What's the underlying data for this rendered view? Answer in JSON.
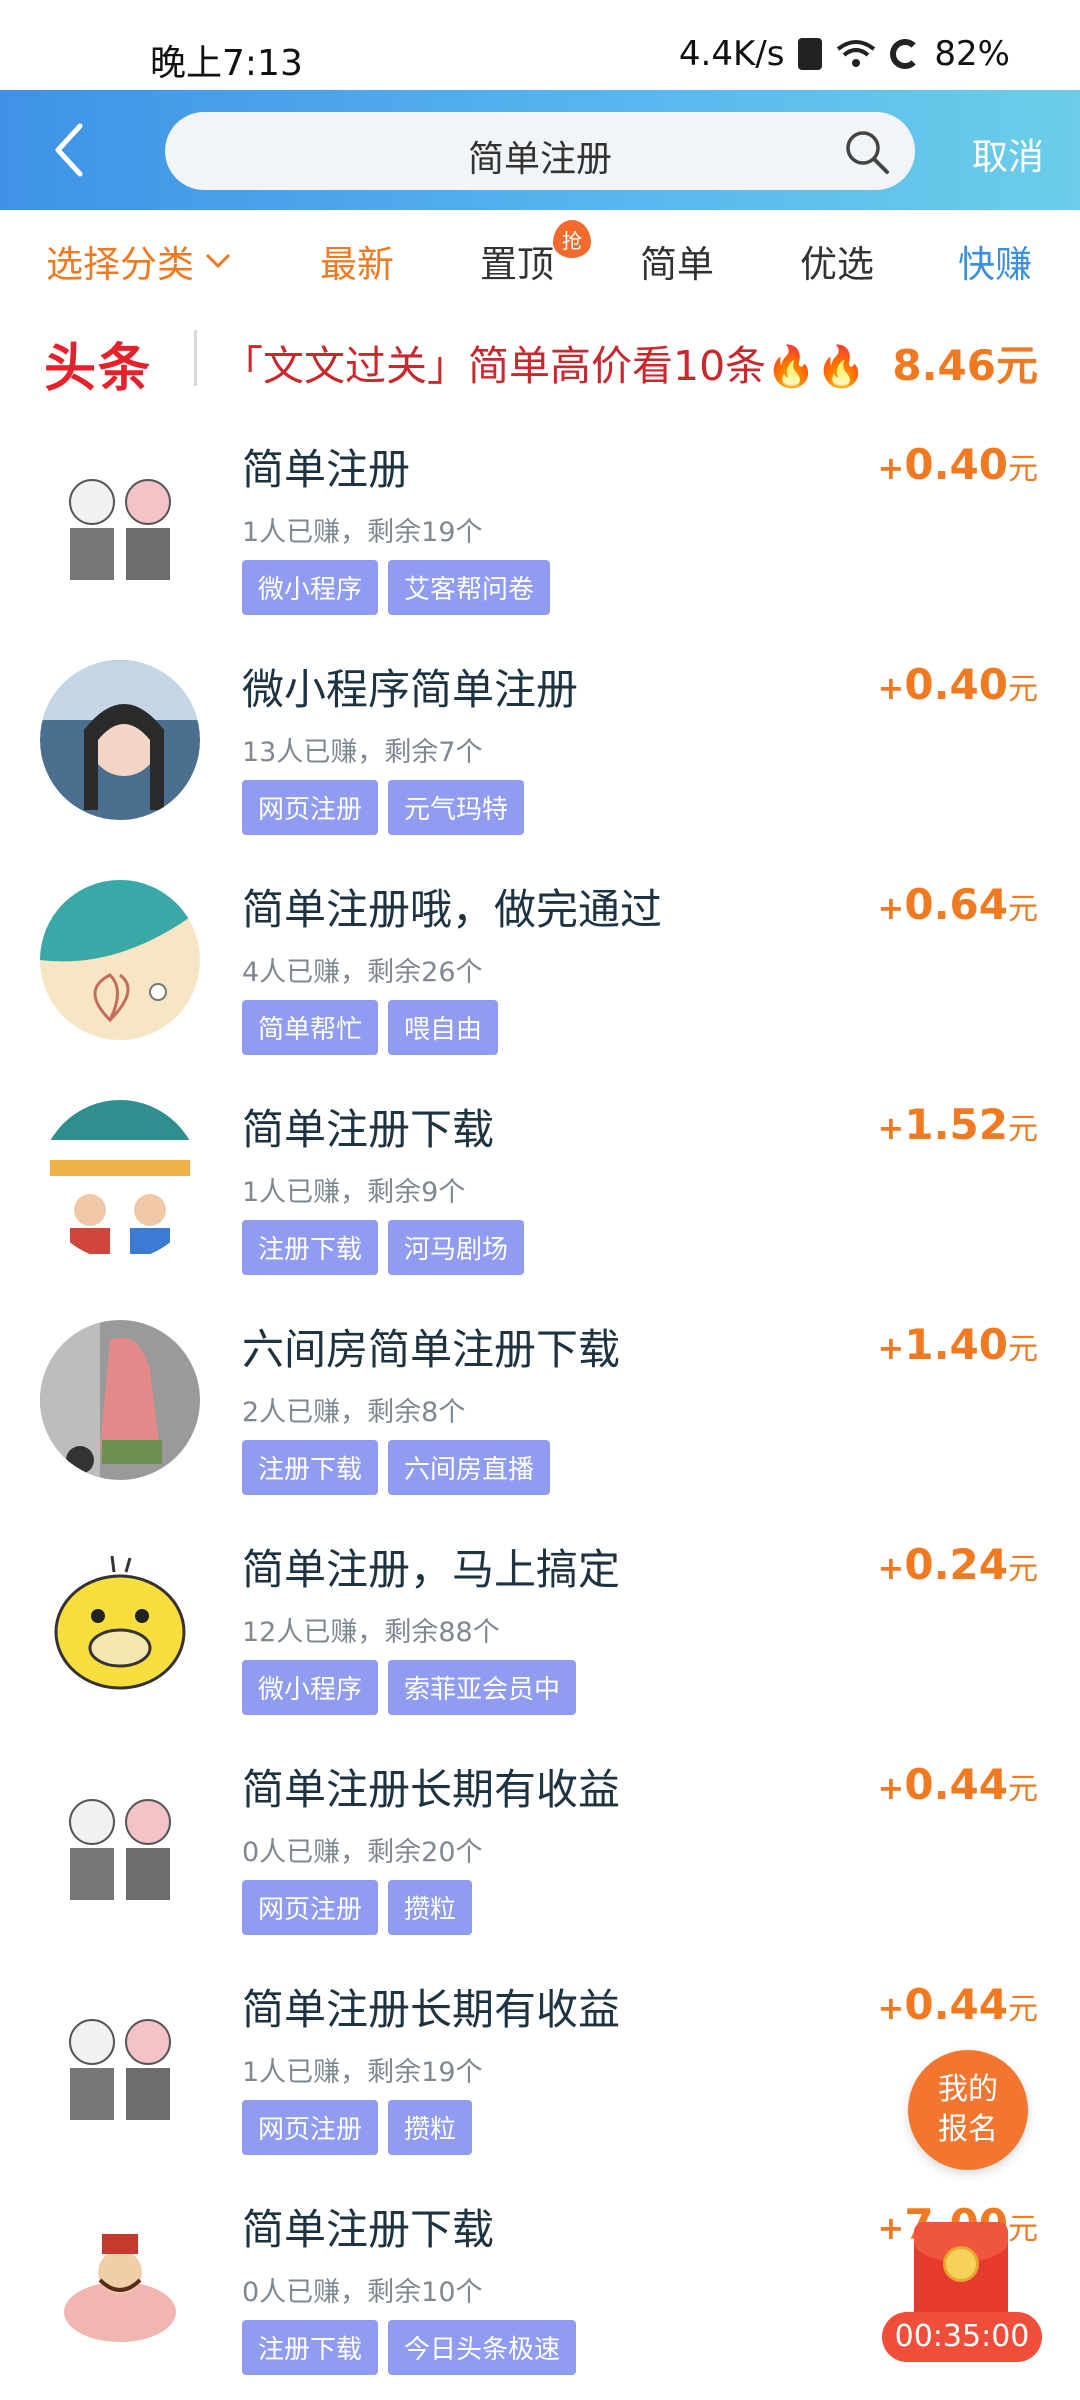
{
  "status_bar": {
    "time": "晚上7:13",
    "speed": "4.4K/s",
    "battery": "82%"
  },
  "header": {
    "search_value": "简单注册",
    "cancel_label": "取消"
  },
  "tabs": {
    "category": "选择分类",
    "items": [
      "最新",
      "置顶",
      "简单",
      "优选",
      "快赚"
    ],
    "badge": "抢"
  },
  "headline": {
    "logo": "头条",
    "text": "「文文过关」简单高价看10条",
    "price": "8.46元"
  },
  "tasks": [
    {
      "title": "简单注册",
      "stats": "1人已赚，剩余19个",
      "tags": [
        "微小程序",
        "艾客帮问卷"
      ],
      "price": "0.40"
    },
    {
      "title": "微小程序简单注册",
      "stats": "13人已赚，剩余7个",
      "tags": [
        "网页注册",
        "元气玛特"
      ],
      "price": "0.40"
    },
    {
      "title": "简单注册哦，做完通过",
      "stats": "4人已赚，剩余26个",
      "tags": [
        "简单帮忙",
        "喂自由"
      ],
      "price": "0.64"
    },
    {
      "title": "简单注册下载",
      "stats": "1人已赚，剩余9个",
      "tags": [
        "注册下载",
        "河马剧场"
      ],
      "price": "1.52"
    },
    {
      "title": "六间房简单注册下载",
      "stats": "2人已赚，剩余8个",
      "tags": [
        "注册下载",
        "六间房直播"
      ],
      "price": "1.40"
    },
    {
      "title": "简单注册，马上搞定",
      "stats": "12人已赚，剩余88个",
      "tags": [
        "微小程序",
        "索菲亚会员中"
      ],
      "price": "0.24"
    },
    {
      "title": "简单注册长期有收益",
      "stats": "0人已赚，剩余20个",
      "tags": [
        "网页注册",
        "攒粒"
      ],
      "price": "0.44"
    },
    {
      "title": "简单注册长期有收益",
      "stats": "1人已赚，剩余19个",
      "tags": [
        "网页注册",
        "攒粒"
      ],
      "price": "0.44"
    },
    {
      "title": "简单注册下载",
      "stats": "0人已赚，剩余10个",
      "tags": [
        "注册下载",
        "今日头条极速"
      ],
      "price": "7.00"
    }
  ],
  "price_prefix": "+",
  "price_unit": "元",
  "floating": {
    "signup_line1": "我的",
    "signup_line2": "报名",
    "timer": "00:35:00"
  },
  "colors": {
    "accent_orange": "#f07a22",
    "tag_bg": "#8f9cf2",
    "header_blue": "#3f92e6",
    "headline_red": "#e5212b"
  }
}
